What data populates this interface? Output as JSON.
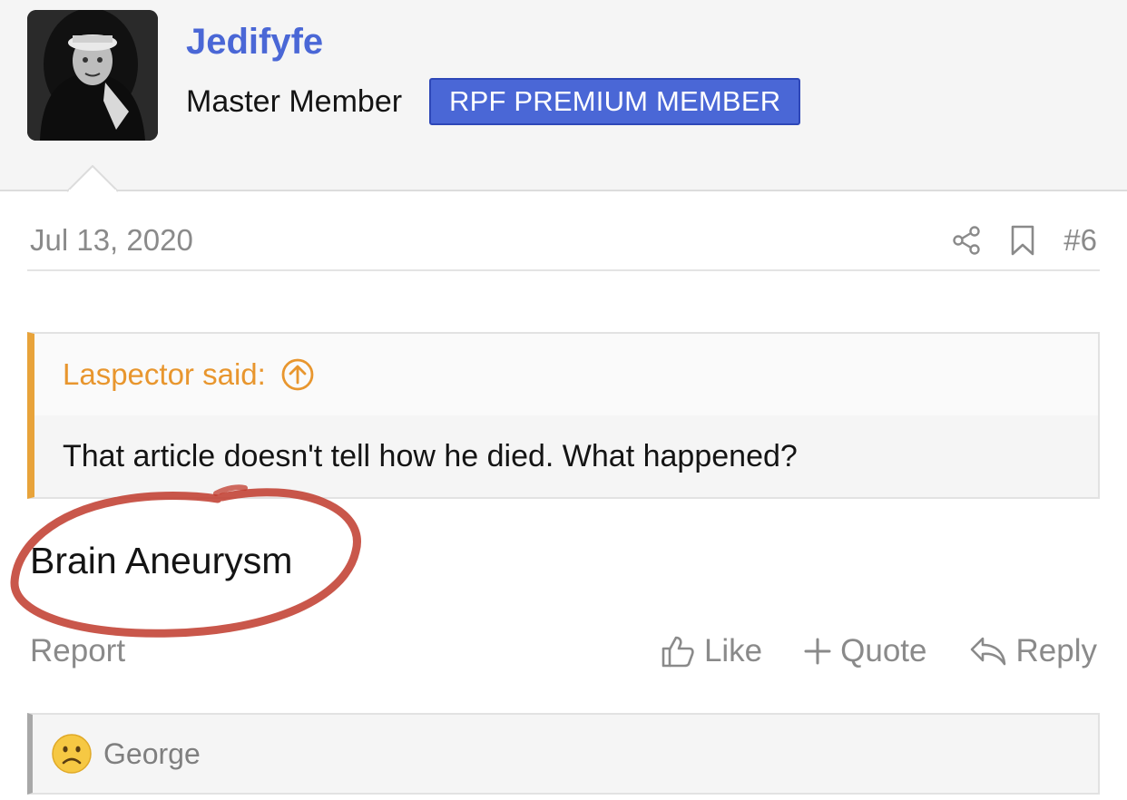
{
  "user": {
    "name": "Jedifyfe",
    "title": "Master Member",
    "badge": "RPF PREMIUM MEMBER"
  },
  "post": {
    "date": "Jul 13, 2020",
    "number": "#6",
    "quote": {
      "author": "Laspector said:",
      "text": "That article doesn't tell how he died. What happened?"
    },
    "message": "Brain Aneurysm"
  },
  "actions": {
    "report": "Report",
    "like": "Like",
    "quote": "Quote",
    "reply": "Reply"
  },
  "reactions": {
    "emoji": "sad-face-icon",
    "user": "George"
  },
  "colors": {
    "accent": "#4a67d6",
    "quote_border": "#e8a33a",
    "quote_author": "#e8962e",
    "annotation": "#c0392b"
  }
}
